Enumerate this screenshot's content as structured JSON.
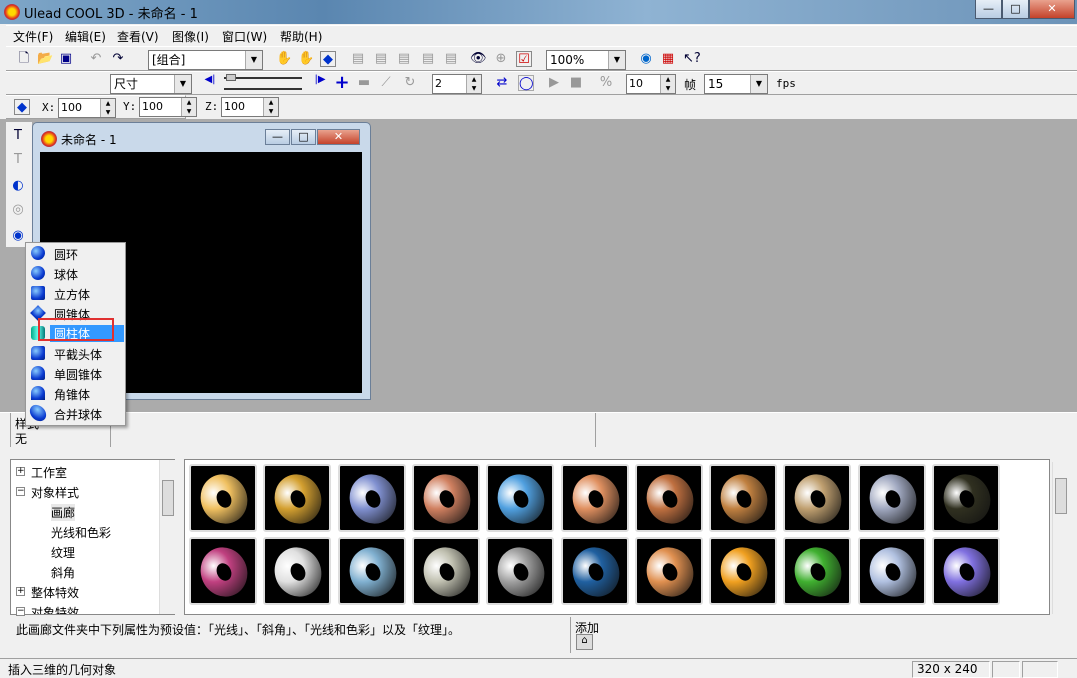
{
  "window": {
    "title": "Ulead COOL 3D - 未命名 - 1",
    "min": "—",
    "max": "□",
    "close": "✕"
  },
  "menu": [
    "文件(F)",
    "编辑(E)",
    "查看(V)",
    "图像(I)",
    "窗口(W)",
    "帮助(H)"
  ],
  "toolbar1": {
    "object_combo": "[组合]",
    "zoom_combo": "100%"
  },
  "toolbar2": {
    "size_combo": "尺寸",
    "segments": "2",
    "frames": "10",
    "frame_label": "帧",
    "fps_value": "15",
    "fps_label": "fps"
  },
  "toolbar3": {
    "x_label": "X:",
    "x": "100",
    "y_label": "Y:",
    "y": "100",
    "z_label": "Z:",
    "z": "100"
  },
  "child": {
    "title": "未命名 - 1"
  },
  "popup": {
    "items": [
      "圆环",
      "球体",
      "立方体",
      "圆锥体",
      "圆柱体",
      "平截头体",
      "单圆锥体",
      "角锥体",
      "合并球体"
    ],
    "selected": "圆柱体",
    "highlight_color": "#3399ff",
    "annotation_color": "#e03030"
  },
  "property": {
    "label": "样式",
    "value": "无"
  },
  "tree": {
    "items": [
      "工作室",
      "对象样式",
      "画廊",
      "光线和色彩",
      "纹理",
      "斜角",
      "整体特效",
      "对象特效"
    ]
  },
  "gallery": {
    "thumbnails": [
      "#f0c060",
      "#d4a030",
      "#8090d0",
      "#d08060",
      "#50a0e0",
      "#e09060",
      "#c07040",
      "#c08040",
      "#c0a070",
      "#a0a8c0",
      "#303020",
      "#c04080",
      "#e0e0e0",
      "#80b0d0",
      "#c0c0b0",
      "#a0a0a0",
      "#2060a0",
      "#e09050",
      "#f0a020",
      "#40b030",
      "#b0c0e0",
      "#8070e0"
    ]
  },
  "description": {
    "text": "此画廊文件夹中下列属性为预设值：「光线」、「斜角」、「光线和色彩」以及「纹理」。",
    "add_label": "添加"
  },
  "status": {
    "text": "插入三维的几何对象",
    "resolution": "320 x 240"
  }
}
